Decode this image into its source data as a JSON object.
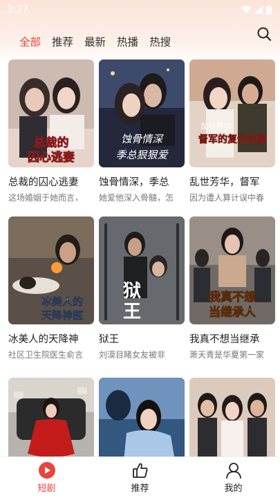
{
  "status": {
    "time": "3:27"
  },
  "tabs": [
    {
      "label": "全部",
      "active": true
    },
    {
      "label": "推荐"
    },
    {
      "label": "最新"
    },
    {
      "label": "热播"
    },
    {
      "label": "热搜"
    }
  ],
  "cards": [
    {
      "title": "总裁的囚心逃妻",
      "desc": "这场婚姻于她而言，",
      "poster_text": "总裁的囚心逃妻",
      "colors": [
        "#c9b7ad",
        "#e7d4cd",
        "#3a2b2b"
      ]
    },
    {
      "title": "蚀骨情深，季总",
      "desc": "她爱他深入骨髓，怎",
      "poster_text": "蚀骨情深季总狠狠爱",
      "colors": [
        "#2a2f45",
        "#5b6a8c",
        "#d8b7a4"
      ]
    },
    {
      "title": "乱世芳华，督军",
      "desc": "因为遭人算计误中春",
      "poster_text": "乱世芳华督军的复仇娇妻",
      "colors": [
        "#e6d8cf",
        "#9b3b2c",
        "#3c2a25"
      ]
    },
    {
      "title": "冰美人的天降神",
      "desc": "社区卫生院医生俞言",
      "poster_text": "冰美人的天降神医",
      "colors": [
        "#6e6153",
        "#c89a63",
        "#2e2a26"
      ]
    },
    {
      "title": "狱王",
      "desc": "刘漠目睹女友被非",
      "poster_text": "狱王",
      "colors": [
        "#5a5d62",
        "#a6a9ad",
        "#262728"
      ]
    },
    {
      "title": "我真不想当继承",
      "desc": "萧天青是华夏第一家",
      "poster_text": "我真不想当继承人",
      "colors": [
        "#6f6b68",
        "#b9aea6",
        "#f2d23d"
      ]
    },
    {
      "title": "",
      "desc": "",
      "poster_text": "",
      "colors": [
        "#b91d1d",
        "#e0e0e0",
        "#2b2b2b"
      ]
    },
    {
      "title": "",
      "desc": "",
      "poster_text": "",
      "colors": [
        "#2c4f79",
        "#8fb3d8",
        "#d8c8b8"
      ]
    },
    {
      "title": "",
      "desc": "",
      "poster_text": "",
      "colors": [
        "#d9c8b8",
        "#f0e6dc",
        "#3b2f28"
      ]
    }
  ],
  "nav": [
    {
      "label": "短剧",
      "icon": "play-circle-icon",
      "active": true
    },
    {
      "label": "推荐",
      "icon": "thumbs-up-icon"
    },
    {
      "label": "我的",
      "icon": "user-icon"
    }
  ],
  "accent": "#e8453c"
}
